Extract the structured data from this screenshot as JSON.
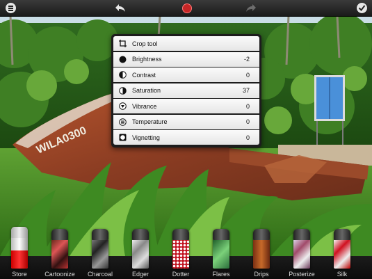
{
  "toolbar": {
    "menu_icon": "menu-icon",
    "undo_icon": "undo-arrow-icon",
    "center_icon": "effects-icon",
    "redo_icon": "redo-arrow-icon",
    "done_icon": "checkmark-icon"
  },
  "photo": {
    "boat_text": "WILA0300"
  },
  "adjust_panel": {
    "rows": [
      {
        "label": "Crop tool",
        "value": "",
        "icon": "crop-icon"
      },
      {
        "label": "Brightness",
        "value": "-2",
        "icon": "brightness-icon"
      },
      {
        "label": "Contrast",
        "value": "0",
        "icon": "contrast-icon"
      },
      {
        "label": "Saturation",
        "value": "37",
        "icon": "saturation-icon"
      },
      {
        "label": "Vibrance",
        "value": "0",
        "icon": "vibrance-icon"
      },
      {
        "label": "Temperature",
        "value": "0",
        "icon": "temperature-icon"
      },
      {
        "label": "Vignetting",
        "value": "0",
        "icon": "vignetting-icon"
      }
    ]
  },
  "filters": [
    {
      "label": "Store"
    },
    {
      "label": "Cartoonize"
    },
    {
      "label": "Charcoal"
    },
    {
      "label": "Edger"
    },
    {
      "label": "Dotter"
    },
    {
      "label": "Flares"
    },
    {
      "label": "Drips"
    },
    {
      "label": "Posterize"
    },
    {
      "label": "Silk"
    }
  ],
  "colors": {
    "panel_bg": "#1d1d1d",
    "row_bg": "#f2f2f2",
    "accent_red": "#c62626",
    "strip_text": "#dddddd"
  }
}
